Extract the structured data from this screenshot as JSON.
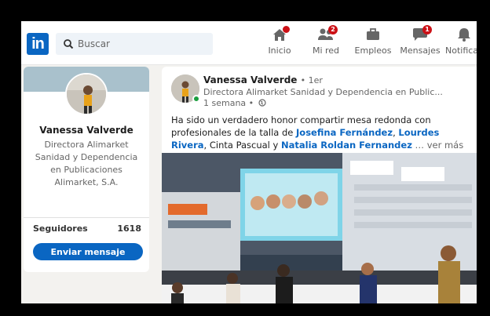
{
  "nav": {
    "logo": "in",
    "search_placeholder": "Buscar",
    "items": [
      {
        "label": "Inicio",
        "badge": "",
        "icon": "home-icon"
      },
      {
        "label": "Mi red",
        "badge": "2",
        "icon": "network-icon"
      },
      {
        "label": "Empleos",
        "badge": "",
        "icon": "briefcase-icon"
      },
      {
        "label": "Mensajes",
        "badge": "1",
        "icon": "messaging-icon"
      },
      {
        "label": "Notificac",
        "badge": "",
        "icon": "bell-icon"
      }
    ]
  },
  "profile": {
    "name": "Vanessa Valverde",
    "headline": "Directora Alimarket Sanidad y Dependencia en Publicaciones Alimarket, S.A.",
    "followers_label": "Seguidores",
    "followers_count": "1618",
    "send_button": "Enviar mensaje"
  },
  "post": {
    "author": "Vanessa Valverde",
    "degree": "• 1er",
    "headline": "Directora Alimarket Sanidad y Dependencia en Public...",
    "time": "1 semana •",
    "text_intro": "Ha sido un verdadero honor compartir mesa redonda con profesionales de la talla de ",
    "mention_1": "Josefina Fernández",
    "sep_1": ", ",
    "mention_2": "Lourdes Rivera",
    "text_mid": ", Cinta Pascual y ",
    "mention_3": "Natalia Roldan Fernandez",
    "more": " … ver más"
  },
  "colors": {
    "brand": "#0a66c2",
    "badge": "#cc1016"
  }
}
